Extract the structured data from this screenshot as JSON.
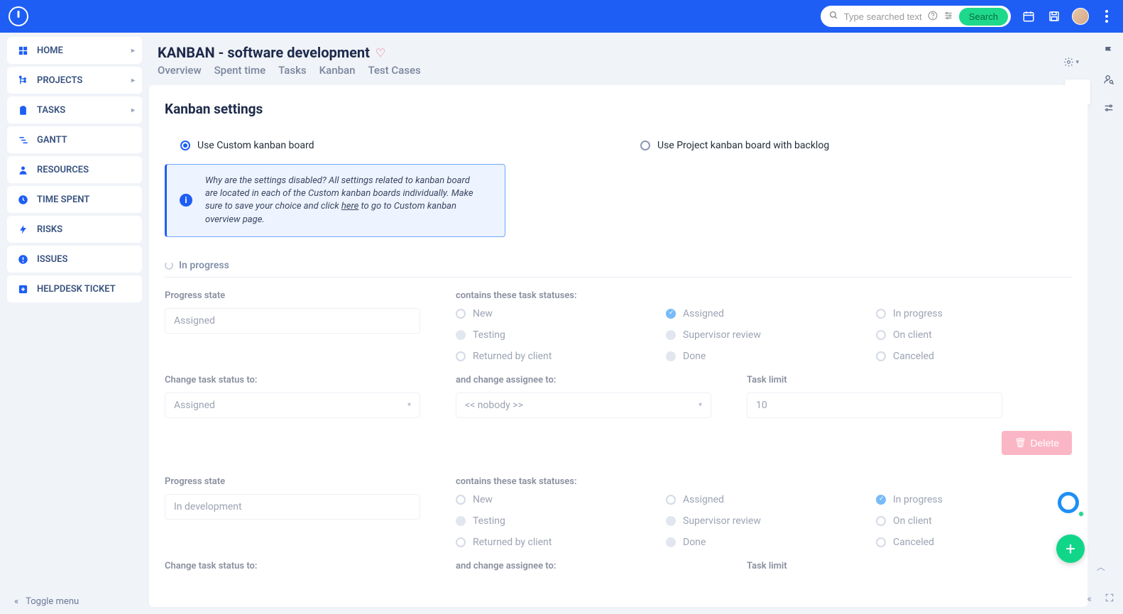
{
  "topbar": {
    "search_placeholder": "Type searched text...",
    "search_button": "Search"
  },
  "sidebar": {
    "items": [
      {
        "icon": "grid",
        "label": "HOME",
        "expandable": true
      },
      {
        "icon": "tree",
        "label": "PROJECTS",
        "expandable": true
      },
      {
        "icon": "clipboard",
        "label": "TASKS",
        "expandable": true
      },
      {
        "icon": "gantt",
        "label": "GANTT",
        "expandable": false
      },
      {
        "icon": "person",
        "label": "RESOURCES",
        "expandable": false
      },
      {
        "icon": "clock",
        "label": "TIME SPENT",
        "expandable": false
      },
      {
        "icon": "bolt",
        "label": "RISKS",
        "expandable": false
      },
      {
        "icon": "alert",
        "label": "ISSUES",
        "expandable": false
      },
      {
        "icon": "plus-box",
        "label": "HELPDESK TICKET",
        "expandable": false
      }
    ],
    "toggle": "Toggle menu"
  },
  "page": {
    "title": "KANBAN - software development",
    "tabs": [
      "Overview",
      "Spent time",
      "Tasks",
      "Kanban",
      "Test Cases"
    ]
  },
  "settings": {
    "heading": "Kanban settings",
    "option_custom": "Use Custom kanban board",
    "option_project": "Use Project kanban board with backlog",
    "info_text": "Why are the settings disabled? All settings related to kanban board are located in each of the Custom kanban boards individually. Make sure to save your choice and click ",
    "info_link": "here",
    "info_text2": " to go to Custom kanban overview page.",
    "section_title": "In progress",
    "labels": {
      "progress_state": "Progress state",
      "contains": "contains these task statuses:",
      "change_status": "Change task status to:",
      "change_assignee": "and change assignee to:",
      "task_limit": "Task limit"
    },
    "statuses": [
      "New",
      "Assigned",
      "In progress",
      "Testing",
      "Supervisor review",
      "On client",
      "Returned by client",
      "Done",
      "Canceled"
    ],
    "blocks": [
      {
        "progress_state": "Assigned",
        "change_status": "Assigned",
        "change_assignee": "<< nobody >>",
        "task_limit": "10",
        "checked": [
          "Assigned"
        ]
      },
      {
        "progress_state": "In development",
        "checked": [
          "In progress"
        ]
      }
    ],
    "delete": "Delete"
  }
}
